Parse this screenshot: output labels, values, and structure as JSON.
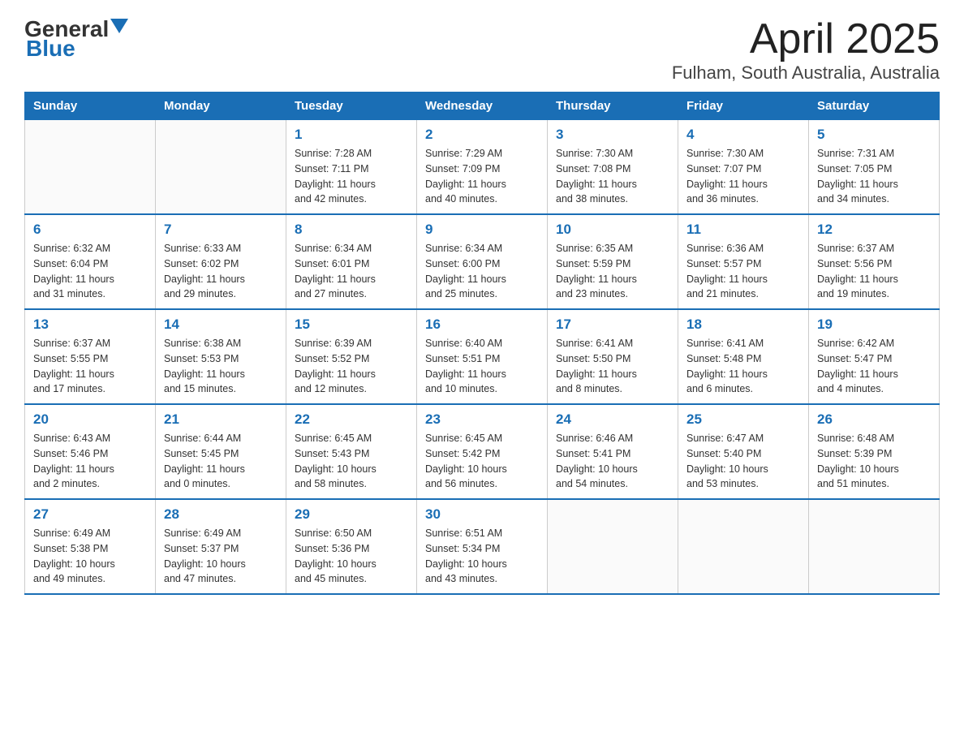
{
  "header": {
    "logo_general": "General",
    "logo_blue": "Blue",
    "title": "April 2025",
    "subtitle": "Fulham, South Australia, Australia"
  },
  "weekdays": [
    "Sunday",
    "Monday",
    "Tuesday",
    "Wednesday",
    "Thursday",
    "Friday",
    "Saturday"
  ],
  "weeks": [
    [
      {
        "day": "",
        "info": ""
      },
      {
        "day": "",
        "info": ""
      },
      {
        "day": "1",
        "info": "Sunrise: 7:28 AM\nSunset: 7:11 PM\nDaylight: 11 hours\nand 42 minutes."
      },
      {
        "day": "2",
        "info": "Sunrise: 7:29 AM\nSunset: 7:09 PM\nDaylight: 11 hours\nand 40 minutes."
      },
      {
        "day": "3",
        "info": "Sunrise: 7:30 AM\nSunset: 7:08 PM\nDaylight: 11 hours\nand 38 minutes."
      },
      {
        "day": "4",
        "info": "Sunrise: 7:30 AM\nSunset: 7:07 PM\nDaylight: 11 hours\nand 36 minutes."
      },
      {
        "day": "5",
        "info": "Sunrise: 7:31 AM\nSunset: 7:05 PM\nDaylight: 11 hours\nand 34 minutes."
      }
    ],
    [
      {
        "day": "6",
        "info": "Sunrise: 6:32 AM\nSunset: 6:04 PM\nDaylight: 11 hours\nand 31 minutes."
      },
      {
        "day": "7",
        "info": "Sunrise: 6:33 AM\nSunset: 6:02 PM\nDaylight: 11 hours\nand 29 minutes."
      },
      {
        "day": "8",
        "info": "Sunrise: 6:34 AM\nSunset: 6:01 PM\nDaylight: 11 hours\nand 27 minutes."
      },
      {
        "day": "9",
        "info": "Sunrise: 6:34 AM\nSunset: 6:00 PM\nDaylight: 11 hours\nand 25 minutes."
      },
      {
        "day": "10",
        "info": "Sunrise: 6:35 AM\nSunset: 5:59 PM\nDaylight: 11 hours\nand 23 minutes."
      },
      {
        "day": "11",
        "info": "Sunrise: 6:36 AM\nSunset: 5:57 PM\nDaylight: 11 hours\nand 21 minutes."
      },
      {
        "day": "12",
        "info": "Sunrise: 6:37 AM\nSunset: 5:56 PM\nDaylight: 11 hours\nand 19 minutes."
      }
    ],
    [
      {
        "day": "13",
        "info": "Sunrise: 6:37 AM\nSunset: 5:55 PM\nDaylight: 11 hours\nand 17 minutes."
      },
      {
        "day": "14",
        "info": "Sunrise: 6:38 AM\nSunset: 5:53 PM\nDaylight: 11 hours\nand 15 minutes."
      },
      {
        "day": "15",
        "info": "Sunrise: 6:39 AM\nSunset: 5:52 PM\nDaylight: 11 hours\nand 12 minutes."
      },
      {
        "day": "16",
        "info": "Sunrise: 6:40 AM\nSunset: 5:51 PM\nDaylight: 11 hours\nand 10 minutes."
      },
      {
        "day": "17",
        "info": "Sunrise: 6:41 AM\nSunset: 5:50 PM\nDaylight: 11 hours\nand 8 minutes."
      },
      {
        "day": "18",
        "info": "Sunrise: 6:41 AM\nSunset: 5:48 PM\nDaylight: 11 hours\nand 6 minutes."
      },
      {
        "day": "19",
        "info": "Sunrise: 6:42 AM\nSunset: 5:47 PM\nDaylight: 11 hours\nand 4 minutes."
      }
    ],
    [
      {
        "day": "20",
        "info": "Sunrise: 6:43 AM\nSunset: 5:46 PM\nDaylight: 11 hours\nand 2 minutes."
      },
      {
        "day": "21",
        "info": "Sunrise: 6:44 AM\nSunset: 5:45 PM\nDaylight: 11 hours\nand 0 minutes."
      },
      {
        "day": "22",
        "info": "Sunrise: 6:45 AM\nSunset: 5:43 PM\nDaylight: 10 hours\nand 58 minutes."
      },
      {
        "day": "23",
        "info": "Sunrise: 6:45 AM\nSunset: 5:42 PM\nDaylight: 10 hours\nand 56 minutes."
      },
      {
        "day": "24",
        "info": "Sunrise: 6:46 AM\nSunset: 5:41 PM\nDaylight: 10 hours\nand 54 minutes."
      },
      {
        "day": "25",
        "info": "Sunrise: 6:47 AM\nSunset: 5:40 PM\nDaylight: 10 hours\nand 53 minutes."
      },
      {
        "day": "26",
        "info": "Sunrise: 6:48 AM\nSunset: 5:39 PM\nDaylight: 10 hours\nand 51 minutes."
      }
    ],
    [
      {
        "day": "27",
        "info": "Sunrise: 6:49 AM\nSunset: 5:38 PM\nDaylight: 10 hours\nand 49 minutes."
      },
      {
        "day": "28",
        "info": "Sunrise: 6:49 AM\nSunset: 5:37 PM\nDaylight: 10 hours\nand 47 minutes."
      },
      {
        "day": "29",
        "info": "Sunrise: 6:50 AM\nSunset: 5:36 PM\nDaylight: 10 hours\nand 45 minutes."
      },
      {
        "day": "30",
        "info": "Sunrise: 6:51 AM\nSunset: 5:34 PM\nDaylight: 10 hours\nand 43 minutes."
      },
      {
        "day": "",
        "info": ""
      },
      {
        "day": "",
        "info": ""
      },
      {
        "day": "",
        "info": ""
      }
    ]
  ]
}
